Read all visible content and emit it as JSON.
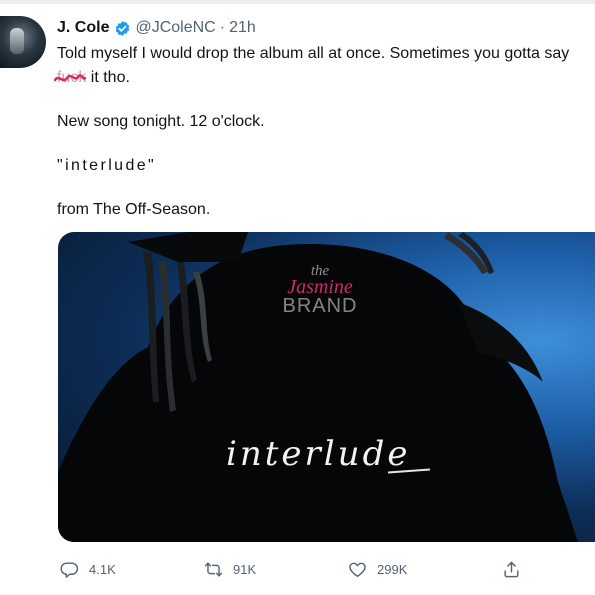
{
  "tweet": {
    "author_name": "J. Cole",
    "author_handle": "@JColeNC",
    "separator": "·",
    "timestamp": "21h",
    "line1": "Told myself I would drop the album all at once. Sometimes you gotta say",
    "line2_censored": "fuck",
    "line2_rest": " it tho.",
    "line3": "New song tonight. 12 o'clock.",
    "line4": "\"interlude\"",
    "line5": "from The Off-Season."
  },
  "media": {
    "caption": "interlude",
    "watermark_the": "the",
    "watermark_jasmine": "Jasmine",
    "watermark_brand": "BRAND"
  },
  "actions": {
    "reply_count": "4.1K",
    "retweet_count": "91K",
    "like_count": "299K"
  },
  "icons": {
    "verified": "verified-badge-icon",
    "reply": "reply-icon",
    "retweet": "retweet-icon",
    "like": "heart-icon",
    "share": "share-icon"
  },
  "colors": {
    "verified_blue": "#1d9bf0",
    "censor_mark": "#e0245e",
    "muted_text": "#536471",
    "watermark_pink": "#d0286e"
  }
}
